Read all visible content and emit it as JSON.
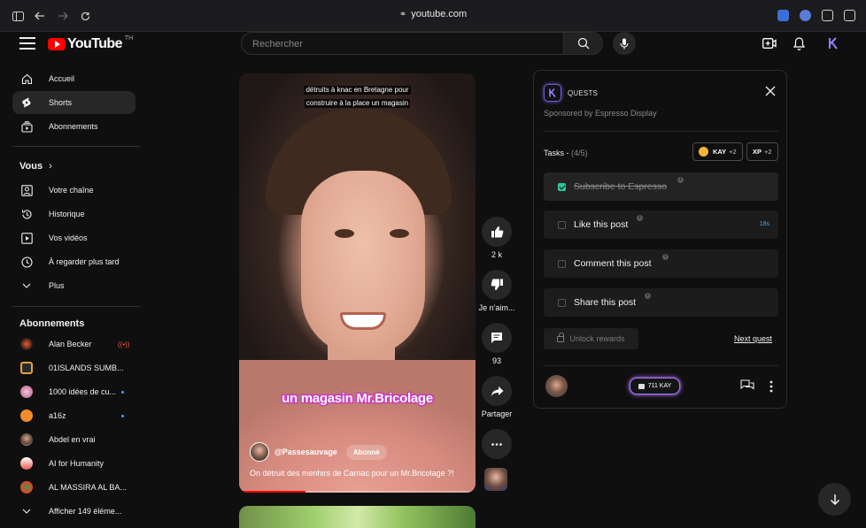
{
  "browser": {
    "url": "youtube.com"
  },
  "header": {
    "logo_text": "YouTube",
    "country_code": "TH",
    "search_placeholder": "Rechercher"
  },
  "sidebar": {
    "main": [
      {
        "label": "Accueil",
        "icon": "home-icon"
      },
      {
        "label": "Shorts",
        "icon": "shorts-icon",
        "active": true
      },
      {
        "label": "Abonnements",
        "icon": "subscriptions-icon"
      }
    ],
    "you_title": "Vous",
    "you": [
      {
        "label": "Votre chaîne",
        "icon": "channel-icon"
      },
      {
        "label": "Historique",
        "icon": "history-icon"
      },
      {
        "label": "Vos vidéos",
        "icon": "your-videos-icon"
      },
      {
        "label": "À regarder plus tard",
        "icon": "watch-later-icon"
      },
      {
        "label": "Plus",
        "icon": "chevron-down-icon"
      }
    ],
    "subs_title": "Abonnements",
    "subs": [
      {
        "label": "Alan Becker",
        "badge": "live",
        "color": "#2b1e1a"
      },
      {
        "label": "01ISLANDS SUMB...",
        "badge": "",
        "color": "#e2a23b"
      },
      {
        "label": "1000 idées de cu...",
        "badge": "dot",
        "color": "#c47aa0"
      },
      {
        "label": "a16z",
        "badge": "dot",
        "color": "#f28c28"
      },
      {
        "label": "Abdel en vrai",
        "badge": "",
        "color": "#8a6a55"
      },
      {
        "label": "AI for Humanity",
        "badge": "",
        "color": "#e85a4f"
      },
      {
        "label": "AL MASSIRA AL BA...",
        "badge": "",
        "color": "#d84a2b"
      }
    ],
    "show_more": "Afficher 149 éléme..."
  },
  "video": {
    "top_caption_line1": "détruits à knac en Bretagne pour",
    "top_caption_line2": "construire à la place un magasin",
    "big_caption": "un magasin Mr.Bricolage",
    "channel": "@Passesauvage",
    "subscribed_label": "Abonné",
    "title": "On détruit des menhirs de Carnac pour un Mr.Bricolage ?!",
    "progress": 0.28
  },
  "actions": {
    "likes": "2 k",
    "dislike_label": "Je n'aim...",
    "comments": "93",
    "share_label": "Partager"
  },
  "quest_panel": {
    "title": "QUESTS",
    "sponsor": "Sponsored by Espresso Display",
    "tasks_label": "Tasks -",
    "tasks_count": "(4/5)",
    "kay_label": "KAY",
    "kay_plus": "+2",
    "xp_label": "XP",
    "xp_plus": "+2",
    "tasks": [
      {
        "label": "Subscribe to Espresso",
        "done": true,
        "timer": ""
      },
      {
        "label": "Like this post",
        "done": false,
        "timer": "18s"
      },
      {
        "label": "Comment this post",
        "done": false,
        "timer": ""
      },
      {
        "label": "Share this post",
        "done": false,
        "timer": ""
      }
    ],
    "unlock_label": "Unlock rewards",
    "next_quest_label": "Next quest",
    "kay_balance": "711 KAY",
    "accent": "#8c7ff0"
  }
}
